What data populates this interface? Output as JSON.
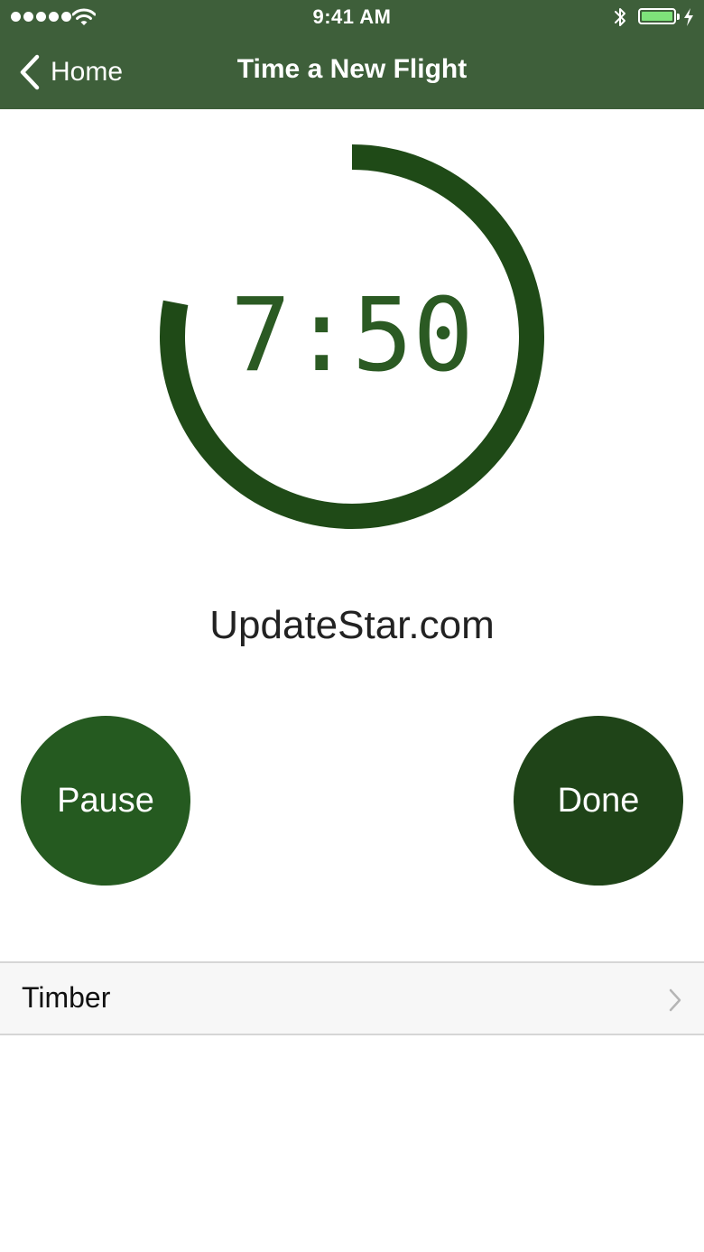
{
  "status_bar": {
    "time": "9:41 AM"
  },
  "nav": {
    "back_label": "Home",
    "title": "Time a New Flight"
  },
  "timer": {
    "display": "7:50",
    "progress_fraction": 0.78
  },
  "watermark": "UpdateStar.com",
  "buttons": {
    "pause_label": "Pause",
    "done_label": "Done"
  },
  "list": {
    "row_label": "Timber"
  },
  "colors": {
    "nav_bar": "#3e5f3a",
    "ring": "#1f4a17",
    "pause": "#255a20",
    "done": "#1f4418"
  },
  "icons": [
    "cellular-signal-icon",
    "wifi-icon",
    "bluetooth-icon",
    "battery-icon",
    "charging-bolt-icon",
    "chevron-left-icon",
    "chevron-right-icon"
  ]
}
